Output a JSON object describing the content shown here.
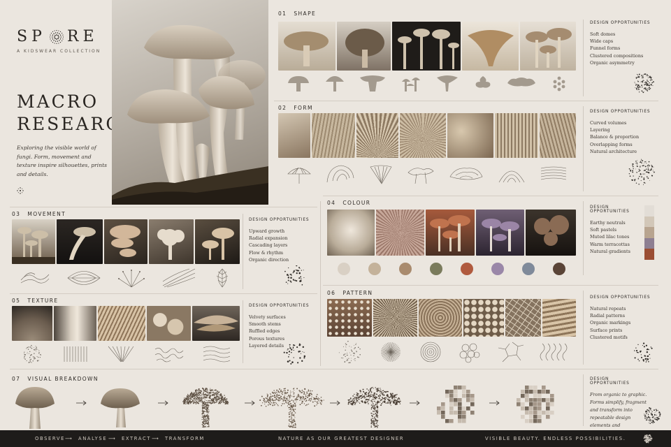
{
  "brand": {
    "logo_left": "SP",
    "logo_right": "RE",
    "subtitle": "A KIDSWEAR COLLECTION"
  },
  "title": {
    "line1": "MACRO",
    "line2": "RESEARCH"
  },
  "intro": "Exploring the visible world of fungi. Form, movement and texture inspire silhouettes, prints and details.",
  "colors": {
    "background": "#ebe6df",
    "text": "#2e2a26",
    "footer": "#1e1c1a",
    "icon_fill": "#a39a8e"
  },
  "sections": {
    "shape": {
      "num": "01",
      "label": "SHAPE",
      "opp_heading": "DESIGN OPPORTUNITIES",
      "opps": [
        "Soft domes",
        "Wide caps",
        "Funnel forms",
        "Clustered compositions",
        "Organic asymmetry"
      ]
    },
    "form": {
      "num": "02",
      "label": "FORM",
      "opp_heading": "DESIGN OPPORTUNITIES",
      "opps": [
        "Curved volumes",
        "Layering",
        "Balance & proportion",
        "Overlapping forms",
        "Natural architecture"
      ]
    },
    "movement": {
      "num": "03",
      "label": "MOVEMENT",
      "opp_heading": "DESIGN OPPORTUNITIES",
      "opps": [
        "Upward growth",
        "Radial expansion",
        "Cascading layers",
        "Flow & rhythm",
        "Organic direction"
      ]
    },
    "colour": {
      "num": "04",
      "label": "COLOUR",
      "opp_heading": "DESIGN OPPORTUNITIES",
      "opps": [
        "Earthy neutrals",
        "Soft pastels",
        "Muted lilac tones",
        "Warm terracottas",
        "Natural gradients"
      ],
      "swatches": [
        "#d9d0c4",
        "#c4b29a",
        "#a98b6e",
        "#7a7b5c",
        "#b05a3e",
        "#9a87a8",
        "#7f8a9a",
        "#5a4437"
      ],
      "bar": [
        "#e2ddd6",
        "#d2c7b8",
        "#b8a48f",
        "#8e7f92",
        "#9b4e33"
      ]
    },
    "texture": {
      "num": "05",
      "label": "TEXTURE",
      "opp_heading": "DESIGN OPPORTUNITIES",
      "opps": [
        "Velvety surfaces",
        "Smooth stems",
        "Ruffled edges",
        "Porous textures",
        "Layered details"
      ]
    },
    "pattern": {
      "num": "06",
      "label": "PATTERN",
      "opp_heading": "DESIGN OPPORTUNITIES",
      "opps": [
        "Natural repeats",
        "Radial patterns",
        "Organic markings",
        "Surface prints",
        "Clustered motifs"
      ]
    },
    "breakdown": {
      "num": "07",
      "label": "VISUAL BREAKDOWN",
      "opp_heading": "DESIGN OPPORTUNITIES",
      "text": "From organic to graphic. Forms simplify, fragment and transform into repeatable design elements and placements."
    }
  },
  "footer": {
    "steps": [
      "OBSERVE",
      "ANALYSE",
      "EXTRACT",
      "TRANSFORM"
    ],
    "center": "NATURE AS OUR GREATEST DESIGNER",
    "right": "VISIBLE BEAUTY. ENDLESS POSSIBILITIES."
  },
  "icons": {
    "logo": "spore-cluster-icon",
    "star": "sparkle-icon",
    "arrow": "arrow-right-icon"
  }
}
